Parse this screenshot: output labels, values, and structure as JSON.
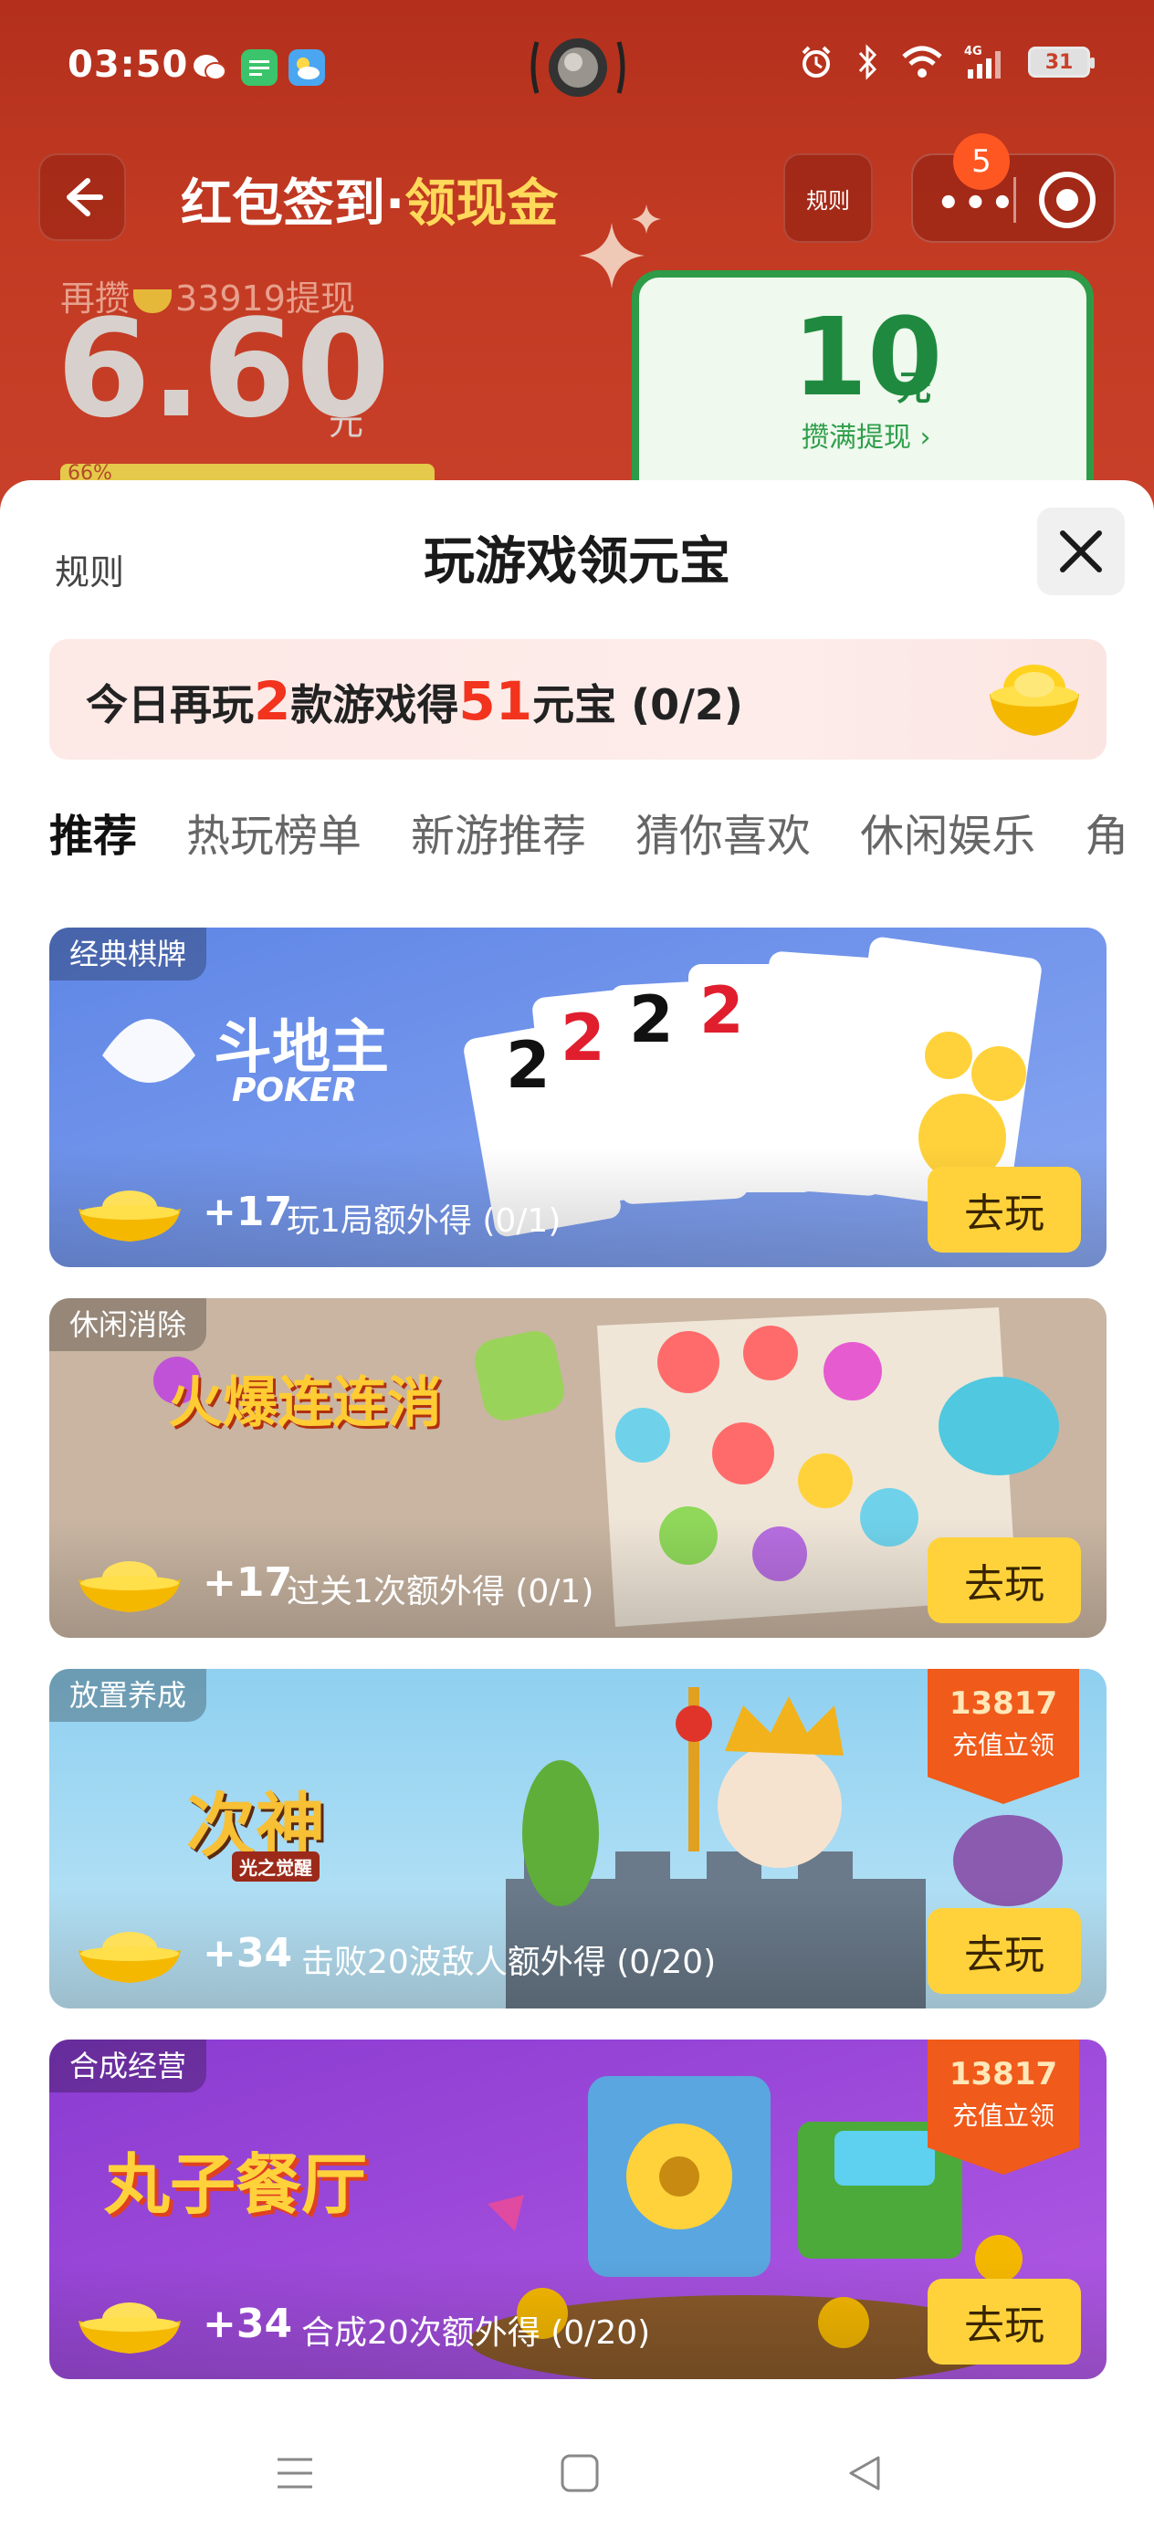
{
  "status_bar": {
    "time": "03:50",
    "battery": "31",
    "network": "4G",
    "icons": [
      "wechat-icon",
      "message-icon",
      "weather-icon",
      "alarm-icon",
      "bluetooth-icon",
      "wifi-icon",
      "signal-icon"
    ]
  },
  "header": {
    "title_main": "红包签到·",
    "title_highlight": "领现金",
    "rules_label": "规则",
    "notification_count": "5"
  },
  "balance": {
    "progress_prefix": "再攒",
    "progress_coins": "33919",
    "progress_suffix": "提现",
    "amount": "6.60",
    "unit": "元",
    "progress_percent": "66%"
  },
  "reward_card": {
    "value": "10",
    "unit": "元",
    "subtitle": "攒满提现 ›"
  },
  "sheet": {
    "rules_label": "规则",
    "title": "玩游戏领元宝",
    "task": {
      "prefix": "今日再玩",
      "games_count": "2",
      "middle": "款游戏得",
      "reward": "51",
      "suffix": "元宝 (0/2)"
    },
    "tabs": [
      "推荐",
      "热玩榜单",
      "新游推荐",
      "猜你喜欢",
      "休闲娱乐",
      "角"
    ],
    "play_label": "去玩",
    "recharge_label": "充值立领"
  },
  "games": [
    {
      "tag": "经典棋牌",
      "name": "斗地主",
      "subname": "POKER",
      "reward": "+17",
      "desc": "玩1局额外得 (0/1)"
    },
    {
      "tag": "休闲消除",
      "name": "火爆连连消",
      "reward": "+17",
      "desc": "过关1次额外得 (0/1)"
    },
    {
      "tag": "放置养成",
      "name": "次神",
      "subname": "光之觉醒",
      "reward": "+34",
      "desc": "击败20波敌人额外得 (0/20)",
      "recharge": "13817"
    },
    {
      "tag": "合成经营",
      "name": "丸子餐厅",
      "reward": "+34",
      "desc": "合成20次额外得 (0/20)",
      "recharge": "13817"
    }
  ],
  "colors": {
    "header_red": "#c23a22",
    "highlight_yellow": "#ffd95a",
    "reward_green": "#1f8a3f",
    "task_red": "#f2331e",
    "play_button": "#ffd23b",
    "recharge_orange": "#f05a1a"
  }
}
